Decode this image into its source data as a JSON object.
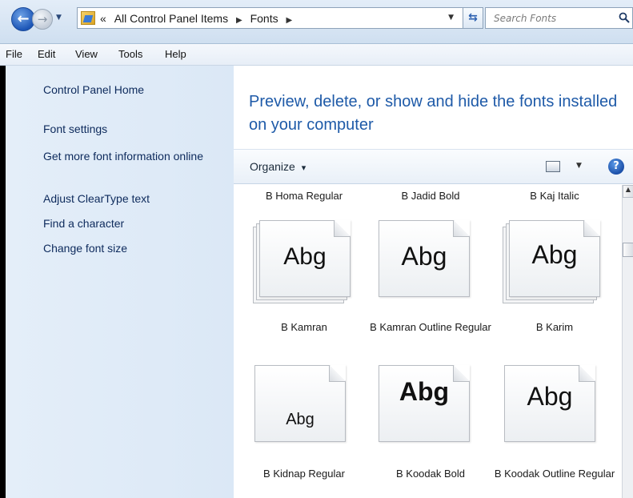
{
  "address": {
    "crumb_prefix": "«",
    "crumbs": [
      "All Control Panel Items",
      "Fonts"
    ]
  },
  "search": {
    "placeholder": "Search Fonts"
  },
  "menu": [
    "File",
    "Edit",
    "View",
    "Tools",
    "Help"
  ],
  "tasks": [
    "Control Panel Home",
    "Font settings",
    "Get more font information online",
    "Adjust ClearType text",
    "Find a character",
    "Change font size"
  ],
  "heading": "Preview, delete, or show and hide the fonts installed on your computer",
  "toolbar": {
    "organize": "Organize",
    "organize_arrow": "▾"
  },
  "preview_text": "Abg",
  "fonts": [
    {
      "name": "B Homa Regular"
    },
    {
      "name": "B Jadid Bold"
    },
    {
      "name": "B Kaj Italic"
    },
    {
      "name": "B Kamran",
      "stacked": true
    },
    {
      "name": "B Kamran Outline Regular",
      "stacked": false
    },
    {
      "name": "B Karim",
      "stacked": true
    },
    {
      "name": "B Kidnap Regular",
      "stacked": false
    },
    {
      "name": "B Koodak Bold",
      "stacked": false
    },
    {
      "name": "B Koodak Outline Regular",
      "stacked": false
    }
  ],
  "colors": {
    "heading": "#1e5aa8",
    "task_link": "#0d2a5c",
    "left_pane": "#dbe8f6"
  }
}
